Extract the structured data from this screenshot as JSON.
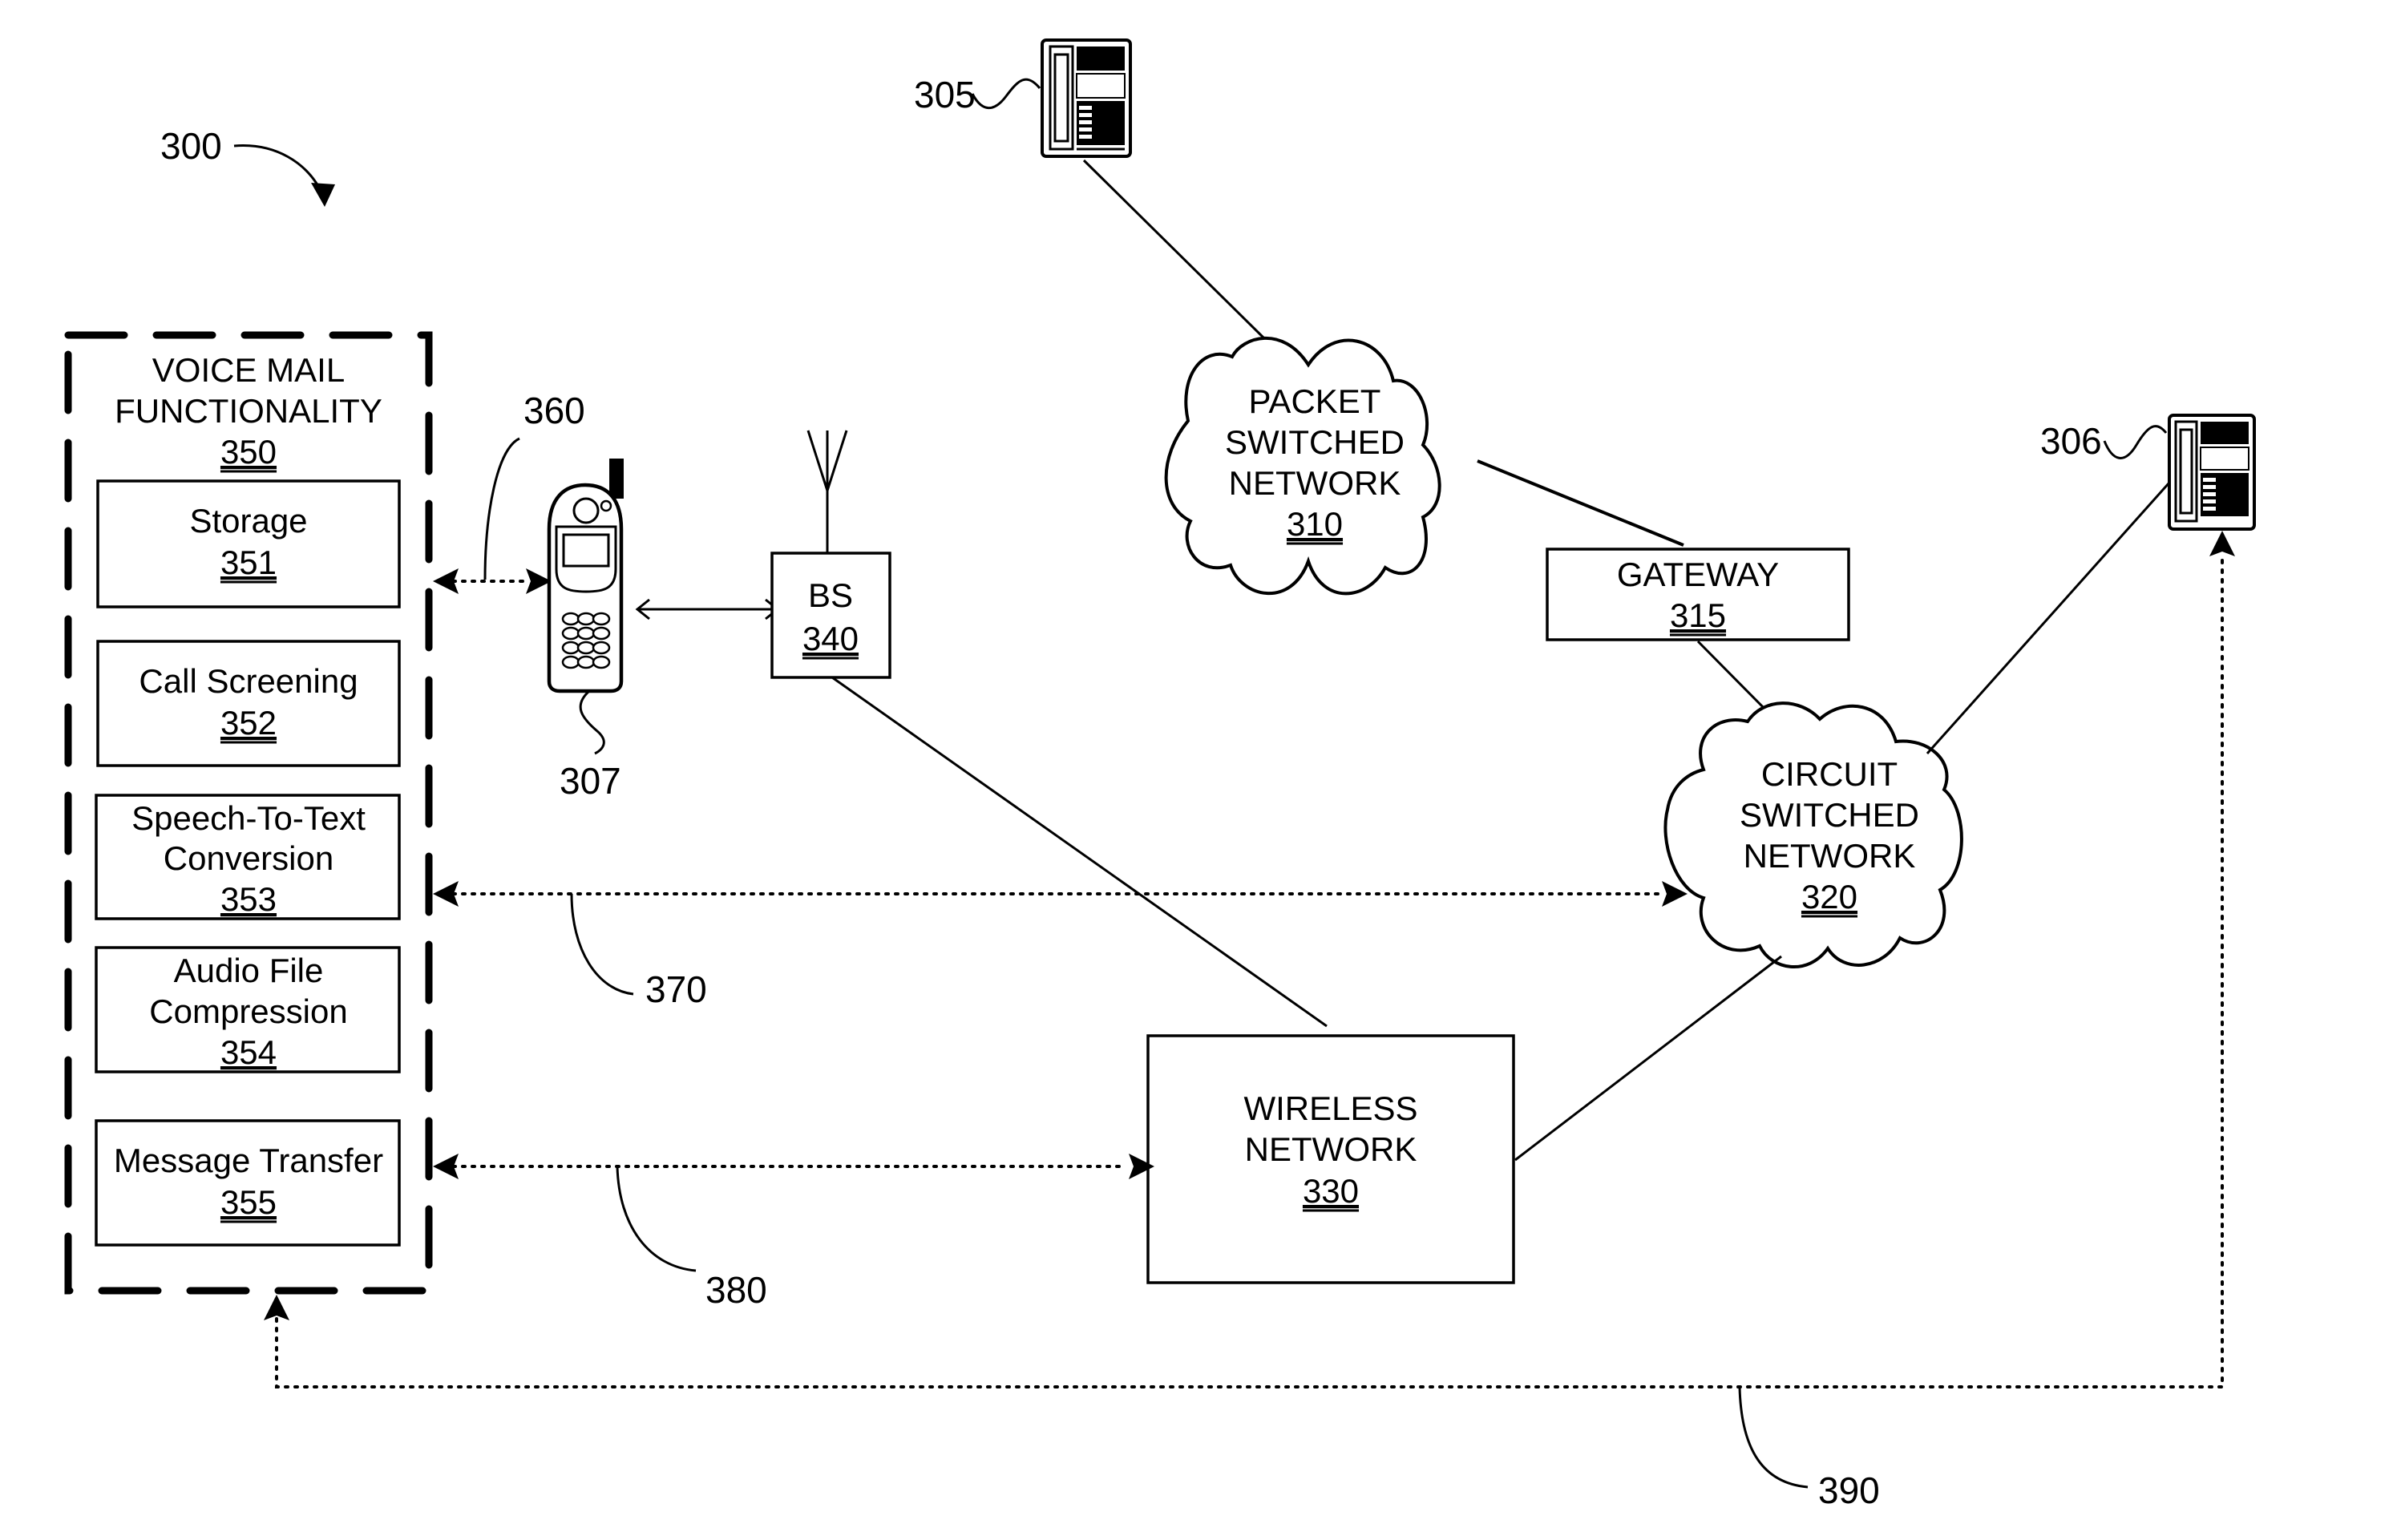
{
  "figure": {
    "ref": "300",
    "voice_mail": {
      "title_line1": "VOICE MAIL",
      "title_line2": "FUNCTIONALITY",
      "ref": "350",
      "modules": [
        {
          "line1": "Storage",
          "line2": "",
          "ref": "351"
        },
        {
          "line1": "Call Screening",
          "line2": "",
          "ref": "352"
        },
        {
          "line1": "Speech-To-Text",
          "line2": "Conversion",
          "ref": "353"
        },
        {
          "line1": "Audio File",
          "line2": "Compression",
          "ref": "354"
        },
        {
          "line1": "Message Transfer",
          "line2": "",
          "ref": "355"
        }
      ]
    },
    "mobile_phone": {
      "ref": "307",
      "icon": "mobile-phone-icon"
    },
    "base_station": {
      "label": "BS",
      "ref": "340",
      "icon": "antenna-icon"
    },
    "packet_network": {
      "line1": "PACKET",
      "line2": "SWITCHED",
      "line3": "NETWORK",
      "ref": "310"
    },
    "gateway": {
      "label": "GATEWAY",
      "ref": "315"
    },
    "circuit_network": {
      "line1": "CIRCUIT",
      "line2": "SWITCHED",
      "line3": "NETWORK",
      "ref": "320"
    },
    "wireless_network": {
      "line1": "WIRELESS",
      "line2": "NETWORK",
      "ref": "330"
    },
    "phone_a": {
      "ref": "305",
      "icon": "desk-phone-icon"
    },
    "phone_b": {
      "ref": "306",
      "icon": "desk-phone-icon"
    },
    "links": {
      "link_360": "360",
      "link_370": "370",
      "link_380": "380",
      "link_390": "390"
    }
  }
}
